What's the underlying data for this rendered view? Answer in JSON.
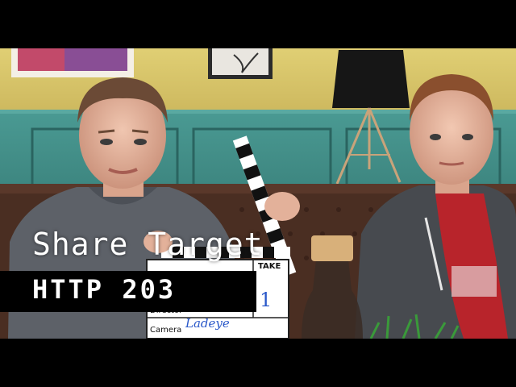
{
  "video": {
    "title": "Share Target",
    "series": "HTTP 203"
  },
  "slate": {
    "take_label": "TAKE",
    "take_value": "1",
    "director_label": "Director",
    "camera_label": "Camera",
    "director_value": "Ladeye"
  },
  "colors": {
    "letterbox": "#000000",
    "wall_yellow": "#d8c76a",
    "wainscot_teal": "#3d8c86",
    "sofa_brown": "#4a2e22",
    "shirt_red": "#b8242b"
  }
}
